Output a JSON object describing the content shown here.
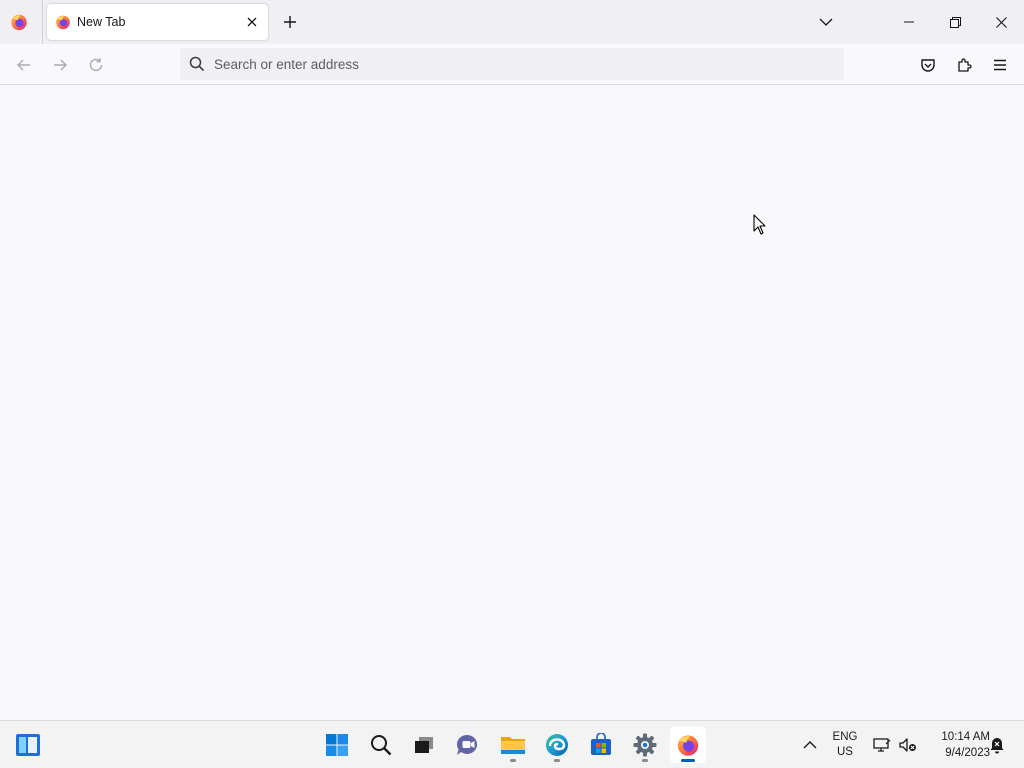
{
  "browser": {
    "tab": {
      "title": "New Tab"
    },
    "urlbar": {
      "placeholder": "Search or enter address",
      "value": ""
    }
  },
  "taskbar": {
    "language": {
      "line1": "ENG",
      "line2": "US"
    },
    "clock": {
      "time": "10:14 AM",
      "date": "9/4/2023"
    },
    "pinned": [
      "widgets-icon",
      "start-icon",
      "search-icon",
      "task-view-icon",
      "chat-icon",
      "file-explorer-icon",
      "edge-icon",
      "store-icon",
      "settings-icon",
      "firefox-icon"
    ],
    "active_app": "firefox"
  },
  "colors": {
    "accent": "#005fb8",
    "content_bg": "#f9f9fb",
    "tabstrip_bg": "#f0f0f4",
    "firefox_orange": "#ff7139",
    "firefox_purple": "#9059ff"
  }
}
